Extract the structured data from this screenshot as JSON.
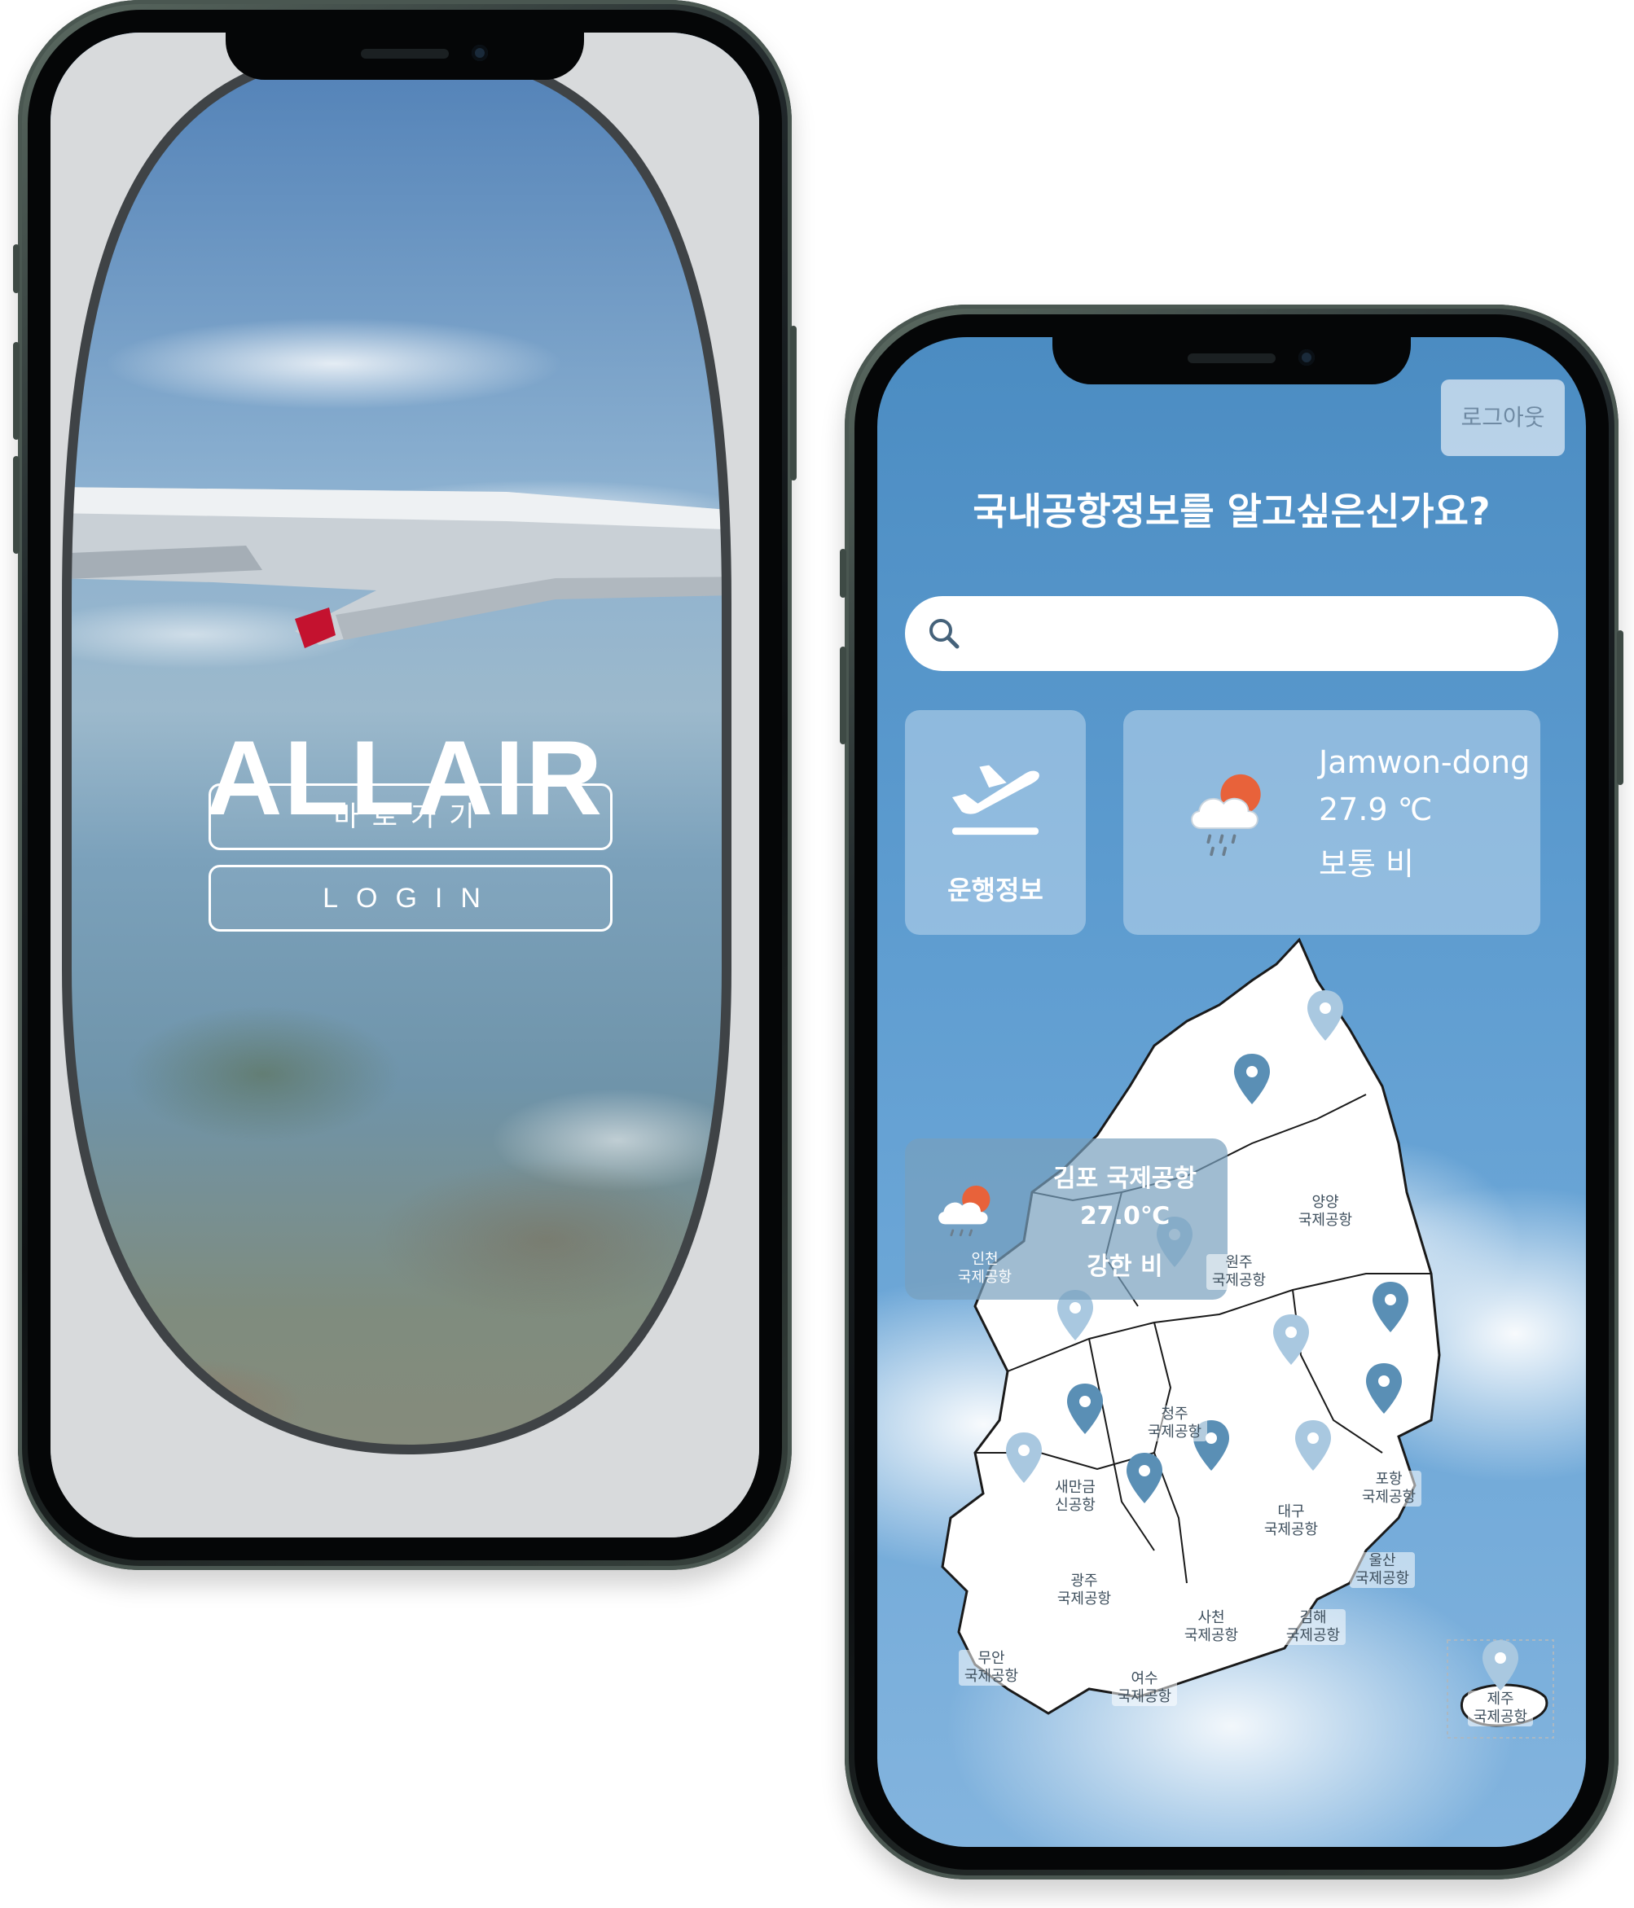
{
  "phone1": {
    "brand": "ALLAIR",
    "buttons": {
      "go_label": "바로가기",
      "login_label": "LOGIN"
    }
  },
  "phone2": {
    "logout_label": "로그아웃",
    "headline": "국내공항정보를 알고싶은신가요?",
    "search": {
      "placeholder": ""
    },
    "flight_card": {
      "label": "운행정보",
      "icon": "airplane-takeoff-icon"
    },
    "weather_card": {
      "location": "Jamwon-dong",
      "temperature": "27.9 ℃",
      "condition": "보통 비",
      "icon": "cloud-rain-sun-icon"
    },
    "gimpo_popup": {
      "name": "김포 국제공항",
      "temperature": "27.0℃",
      "condition": "강한 비"
    },
    "airports": [
      {
        "name": "인천",
        "sub": "국제공항"
      },
      {
        "name": "원주",
        "sub": "국제공항"
      },
      {
        "name": "양양",
        "sub": "국제공항"
      },
      {
        "name": "청주",
        "sub": "국제공항"
      },
      {
        "name": "새만금",
        "sub": "신공항"
      },
      {
        "name": "대구",
        "sub": "국제공항"
      },
      {
        "name": "포항",
        "sub": "국제공항"
      },
      {
        "name": "울산",
        "sub": "국제공항"
      },
      {
        "name": "광주",
        "sub": "국제공항"
      },
      {
        "name": "무안",
        "sub": "국제공항"
      },
      {
        "name": "여수",
        "sub": "국제공항"
      },
      {
        "name": "사천",
        "sub": "국제공항"
      },
      {
        "name": "김해",
        "sub": "국제공항"
      },
      {
        "name": "제주",
        "sub": "국제공항"
      }
    ],
    "colors": {
      "pin_dark": "#5a8fb5",
      "pin_light": "#a9c8e0"
    }
  }
}
